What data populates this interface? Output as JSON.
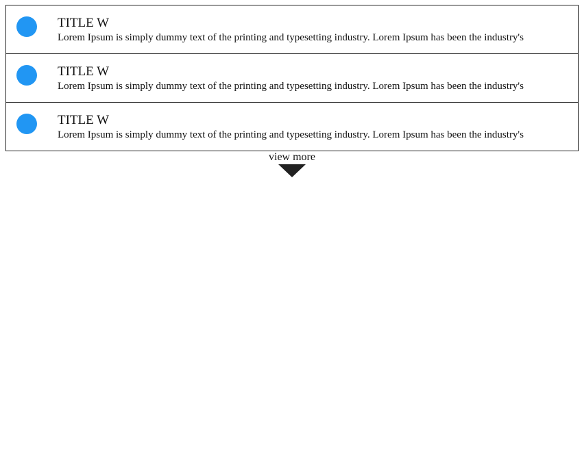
{
  "list": {
    "items": [
      {
        "title": "TITLE W",
        "description": "Lorem Ipsum is simply dummy text of the printing and typesetting industry. Lorem Ipsum has been the industry's",
        "icon": "blue-circle-icon"
      },
      {
        "title": "TITLE W",
        "description": "Lorem Ipsum is simply dummy text of the printing and typesetting industry. Lorem Ipsum has been the industry's",
        "icon": "blue-circle-icon"
      },
      {
        "title": "TITLE W",
        "description": "Lorem Ipsum is simply dummy text of the printing and typesetting industry. Lorem Ipsum has been the industry's",
        "icon": "blue-circle-icon"
      }
    ]
  },
  "view_more": {
    "label": "view more",
    "icon": "caret-down-icon"
  },
  "colors": {
    "accent": "#2196F3",
    "border": "#222222",
    "text": "#111111"
  }
}
